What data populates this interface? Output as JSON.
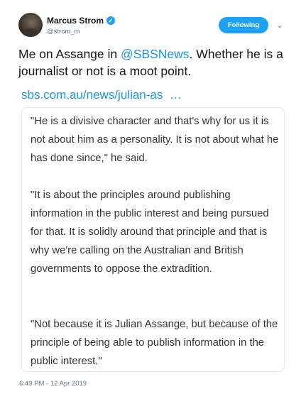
{
  "author": {
    "name": "Marcus Strom",
    "handle": "@strom_m",
    "verified_glyph": "✓"
  },
  "follow_button": {
    "label": "Following",
    "color": "#1da1f2"
  },
  "menu_caret": "⌄",
  "tweet": {
    "text_before": "Me on Assange in ",
    "mention": "@SBSNews",
    "text_after": ". Whether he is a journalist or not is a moot point.",
    "link": "sbs.com.au/news/julian-as  …"
  },
  "quote": {
    "paragraphs": [
      "\"He is a divisive character and that's why for us it is not about him as a personality. It is not about what he has done since,\" he said.",
      "\"It is about the principles around publishing information in the public interest and being pursued for that. It is solidly around that principle and that is why we're calling on the Australian and British governments to oppose the extradition.",
      "\"Not because it is Julian Assange, but because of the principle of being able to publish information in the public interest.\""
    ]
  },
  "timestamp": "6:49 PM - 12 Apr 2019",
  "colors": {
    "link": "#1b95e0",
    "muted": "#657786"
  }
}
